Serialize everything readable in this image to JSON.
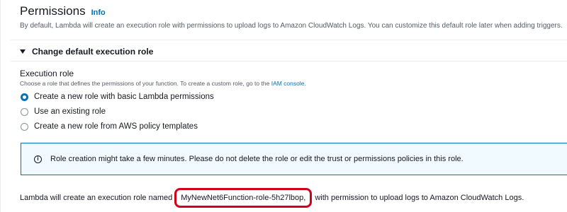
{
  "permissions": {
    "title": "Permissions",
    "info_label": "Info",
    "description": "By default, Lambda will create an execution role with permissions to upload logs to Amazon CloudWatch Logs. You can customize this default role later when adding triggers.",
    "expander_label": "Change default execution role",
    "execution_role": {
      "label": "Execution role",
      "description": "Choose a role that defines the permissions of your function. To create a custom role, go to the",
      "link_text": "IAM console",
      "description_end": ".",
      "options": [
        {
          "label": "Create a new role with basic Lambda permissions",
          "selected": true
        },
        {
          "label": "Use an existing role",
          "selected": false
        },
        {
          "label": "Create a new role from AWS policy templates",
          "selected": false
        }
      ]
    },
    "alert": {
      "icon": "info-icon",
      "text": "Role creation might take a few minutes. Please do not delete the role or edit the trust or permissions policies in this role."
    },
    "footer": {
      "prefix": "Lambda will create an execution role named",
      "role_name": "MyNewNet6Function-role-5h27lbop,",
      "suffix": "with permission to upload logs to Amazon CloudWatch Logs."
    },
    "colors": {
      "link": "#0073bb",
      "alert_bg": "#f1faff",
      "highlight": "#d0021b"
    }
  }
}
